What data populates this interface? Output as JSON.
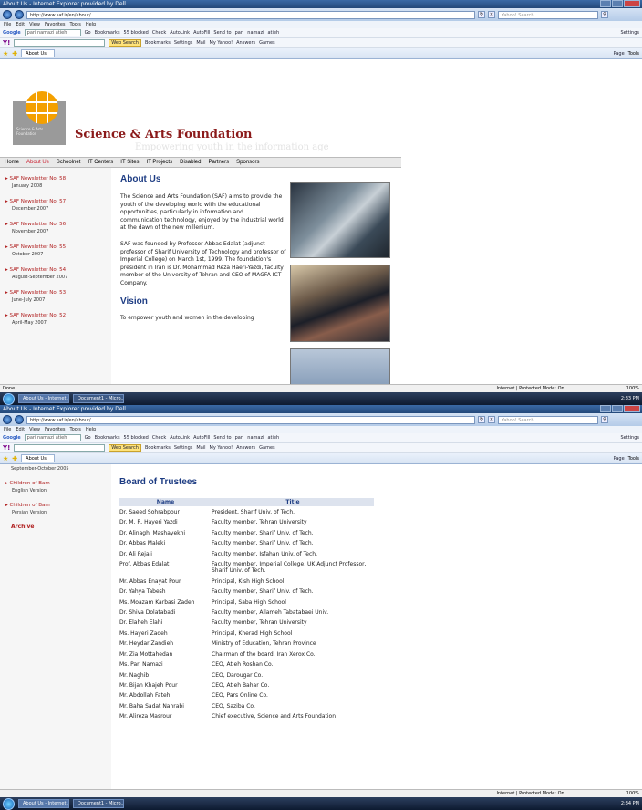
{
  "browser": {
    "title": "About Us - Internet Explorer provided by Dell",
    "url": "http://www.saf.ir/en/about/",
    "search_placeholder": "Yahoo! Search",
    "menu": [
      "File",
      "Edit",
      "View",
      "Favorites",
      "Tools",
      "Help"
    ],
    "google_query": "pari namazi atieh",
    "google_items": [
      "Go",
      "Bookmarks",
      "55 blocked",
      "Check",
      "AutoLink",
      "AutoFill",
      "Send to",
      "pari",
      "namazi",
      "atieh",
      "Settings"
    ],
    "yahoo_items": [
      "Web Search",
      "Bookmarks",
      "Settings",
      "Mail",
      "My Yahoo!",
      "Answers",
      "Games"
    ],
    "tab_label": "About Us",
    "tab_tools": [
      "Page",
      "Tools"
    ],
    "status_done": "Done",
    "status_zone": "Internet | Protected Mode: On",
    "zoom": "100%",
    "taskbar": [
      "About Us - Internet ...",
      "Document1 - Micro..."
    ],
    "clock1": "2:33 PM",
    "clock2": "2:34 PM"
  },
  "site": {
    "logo_text": "Science & Arts Foundation",
    "name": "Science & Arts Foundation",
    "tagline": "Empowering youth in the information age",
    "nav": [
      "Home",
      "About Us",
      "Schoolnet",
      "IT Centers",
      "IT Sites",
      "IT Projects",
      "Disabled",
      "Partners",
      "Sponsors"
    ],
    "newsletters": [
      {
        "title": "SAF Newsletter No. 58",
        "date": "January 2008"
      },
      {
        "title": "SAF Newsletter No. 57",
        "date": "December 2007"
      },
      {
        "title": "SAF Newsletter No. 56",
        "date": "November 2007"
      },
      {
        "title": "SAF Newsletter No. 55",
        "date": "October 2007"
      },
      {
        "title": "SAF Newsletter No. 54",
        "date": "August-September 2007"
      },
      {
        "title": "SAF Newsletter No. 53",
        "date": "June-July 2007"
      },
      {
        "title": "SAF Newsletter No. 52",
        "date": "April-May 2007"
      }
    ],
    "about_heading": "About Us",
    "about_p1": "The Science and Arts Foundation (SAF) aims to provide the youth of the developing world with the educational opportunities, particularly in information and communication technology, enjoyed by the industrial world at the dawn of the new millenium.",
    "about_p2": "SAF was founded by Professor Abbas Edalat (adjunct professor of Sharif University of Technology and professor of Imperial College) on March 1st, 1999. The foundation's president in Iran is Dr. Mohammad Reza Haeri-Yazdi, faculty member of the University of Tehran and CEO of MAGFA ICT Company.",
    "vision_heading": "Vision",
    "vision_p": "To empower youth and women in the developing"
  },
  "page2": {
    "sidebar_top": "September-October 2005",
    "children": [
      {
        "title": "Children of Bam",
        "sub": "English Version"
      },
      {
        "title": "Children of Bam",
        "sub": "Persian Version"
      }
    ],
    "archive": "Archive",
    "board_heading": "Board of Trustees",
    "col_name": "Name",
    "col_title": "Title",
    "rows": [
      {
        "name": "Dr. Saeed Sohrabpour",
        "title": "President, Sharif Univ. of Tech."
      },
      {
        "name": "Dr. M. R. Hayeri Yazdi",
        "title": "Faculty member, Tehran University"
      },
      {
        "name": "Dr. Alinaghi Mashayekhi",
        "title": "Faculty member, Sharif Univ. of Tech."
      },
      {
        "name": "Dr. Abbas Maleki",
        "title": "Faculty member, Sharif Univ. of Tech."
      },
      {
        "name": "Dr. Ali Rejali",
        "title": "Faculty member, Isfahan Univ. of Tech."
      },
      {
        "name": "Prof. Abbas Edalat",
        "title": "Faculty member, Imperial College, UK Adjunct Professor, Sharif Univ. of Tech."
      },
      {
        "name": "Mr. Abbas Enayat Pour",
        "title": "Principal, Kish High School"
      },
      {
        "name": "Dr. Yahya Tabesh",
        "title": "Faculty member, Sharif Univ. of Tech."
      },
      {
        "name": "Ms. Moazam Karbasi Zadeh",
        "title": "Principal, Saba High School"
      },
      {
        "name": "Dr. Shiva Dolatabadi",
        "title": "Faculty member, Allameh Tabatabaei Univ."
      },
      {
        "name": "Dr. Elaheh Elahi",
        "title": "Faculty member, Tehran University"
      },
      {
        "name": "Ms. Hayeri Zadeh",
        "title": "Principal, Kherad High School"
      },
      {
        "name": "Mr. Heydar Zandieh",
        "title": "Ministry of Education, Tehran Province"
      },
      {
        "name": "Mr. Zia Mottahedan",
        "title": "Chairman of the board, Iran Xerox Co."
      },
      {
        "name": "Ms. Pari Namazi",
        "title": "CEO, Atieh Roshan Co."
      },
      {
        "name": "Mr. Naghib",
        "title": "CEO, Darougar Co."
      },
      {
        "name": "Mr. Bijan Khajeh Pour",
        "title": "CEO, Atieh Bahar Co."
      },
      {
        "name": "Mr. Abdollah Fateh",
        "title": "CEO, Pars Online Co."
      },
      {
        "name": "Mr. Baha Sadat Nahrabi",
        "title": "CEO, Saziba Co."
      },
      {
        "name": "Mr. Alireza Masrour",
        "title": "Chief executive, Science and Arts Foundation"
      }
    ]
  }
}
